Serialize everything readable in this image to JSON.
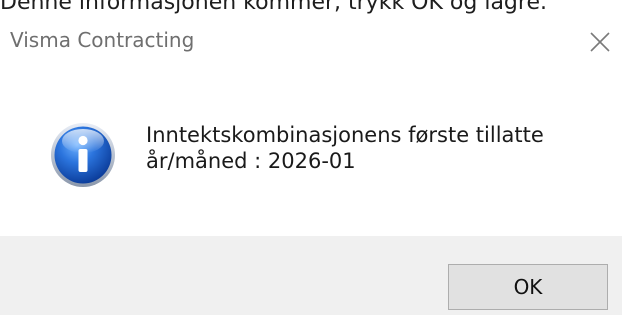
{
  "caption": "Denne informasjonen kommer, trykk OK og lagre.",
  "dialog": {
    "title": "Visma Contracting",
    "message_line1": "Inntektskombinasjonens første tillatte",
    "message_line2": "år/måned : 2026-01",
    "ok_label": "OK",
    "icon": "info-icon",
    "close_icon": "close-icon"
  },
  "colors": {
    "footer_bg": "#f0f0f0",
    "button_bg": "#e1e1e1",
    "button_border": "#adadad",
    "icon_blue": "#1b5fc9"
  }
}
